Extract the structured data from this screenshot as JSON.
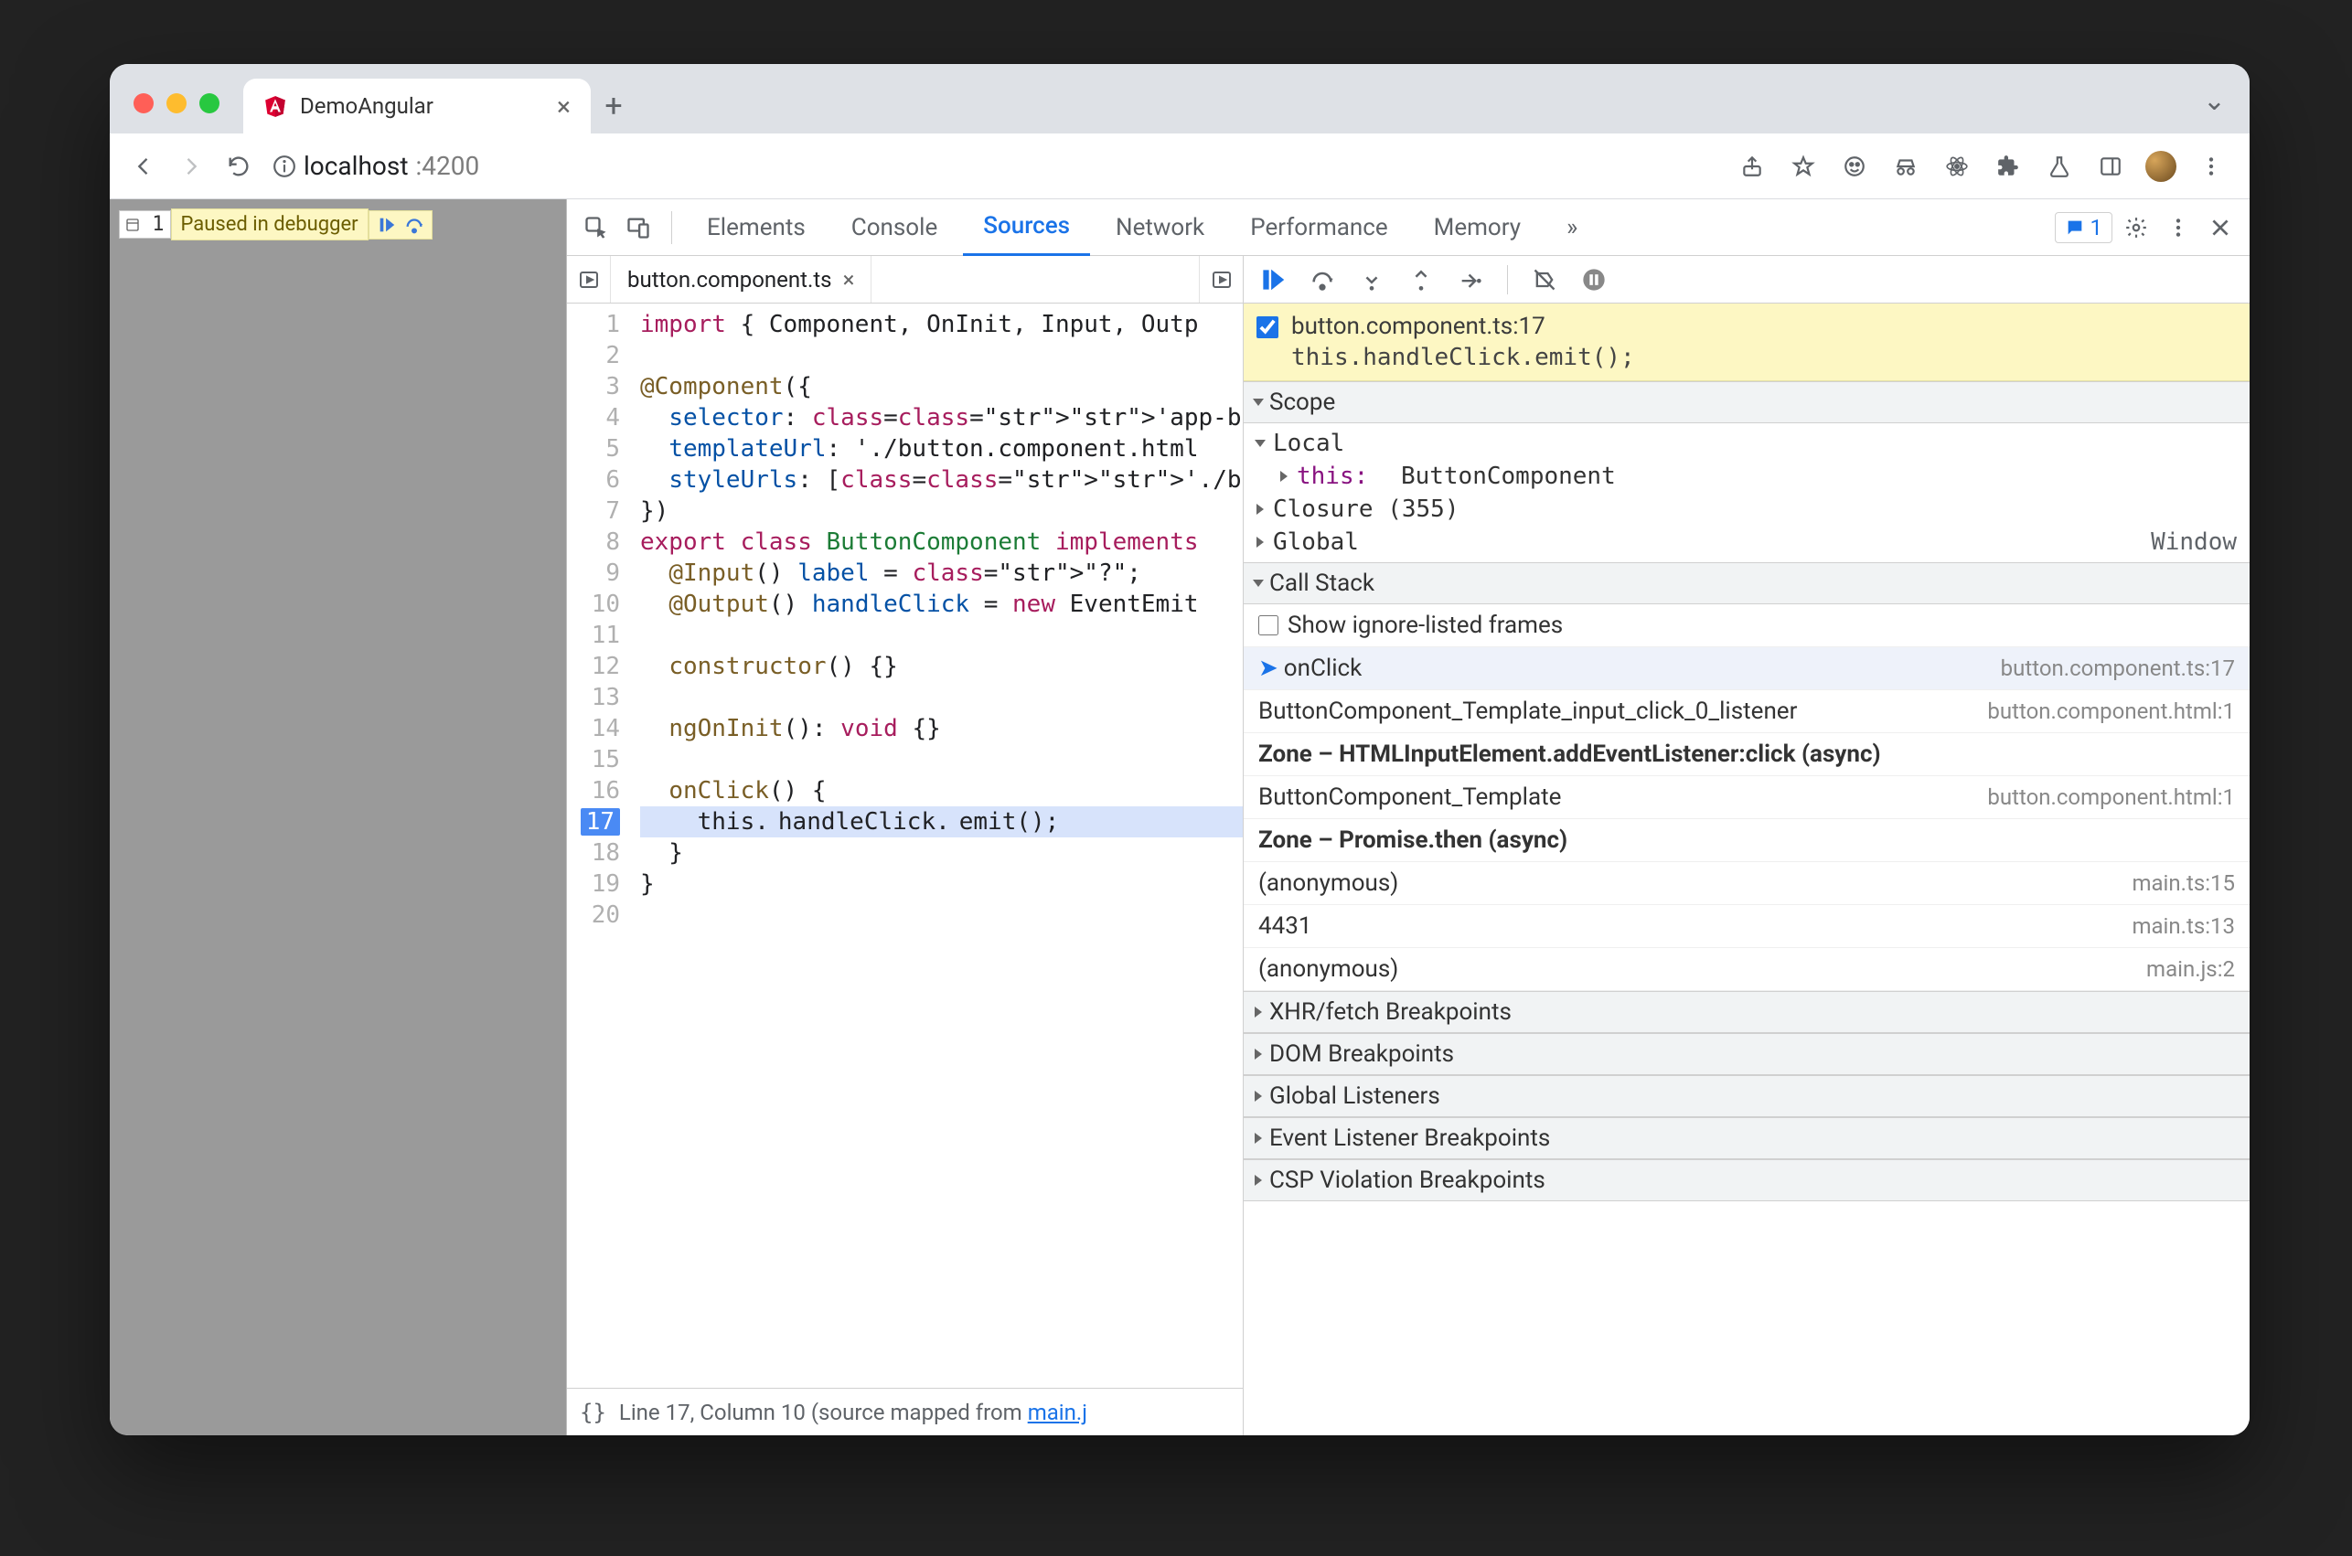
{
  "browser": {
    "tab_title": "DemoAngular",
    "new_tab": "+",
    "url_host": "localhost",
    "url_port": ":4200"
  },
  "paused_overlay": {
    "line_badge": "1",
    "label": "Paused in debugger"
  },
  "devtools_tabs": {
    "elements": "Elements",
    "console": "Console",
    "sources": "Sources",
    "network": "Network",
    "performance": "Performance",
    "memory": "Memory",
    "more": "»",
    "issues_count": "1"
  },
  "file_tab": {
    "name": "button.component.ts"
  },
  "code": {
    "lines": [
      "import { Component, OnInit, Input, Outp",
      "",
      "@Component({",
      "  selector: 'app-button',",
      "  templateUrl: './button.component.html",
      "  styleUrls: ['./button.component.css']",
      "})",
      "export class ButtonComponent implements",
      "  @Input() label = \"?\";",
      "  @Output() handleClick = new EventEmit",
      "",
      "  constructor() {}",
      "",
      "  ngOnInit(): void {}",
      "",
      "  onClick() {",
      "    this.handleClick.emit();",
      "  }",
      "}",
      ""
    ],
    "line_numbers": [
      "1",
      "2",
      "3",
      "4",
      "5",
      "6",
      "7",
      "8",
      "9",
      "10",
      "11",
      "12",
      "13",
      "14",
      "15",
      "16",
      "17",
      "18",
      "19",
      "20"
    ],
    "paused_line_index": 16
  },
  "statusbar": {
    "pretty": "{}",
    "text_prefix": "Line 17, Column 10  (source mapped from ",
    "link": "main.j"
  },
  "breakpoint_banner": {
    "title": "button.component.ts:17",
    "expr": "this.handleClick.emit();"
  },
  "scope": {
    "header": "Scope",
    "local": "Local",
    "this_label": "this:",
    "this_value": "ButtonComponent",
    "closure": "Closure (355)",
    "global": "Global",
    "global_value": "Window"
  },
  "callstack": {
    "header": "Call Stack",
    "show_ignored": "Show ignore-listed frames",
    "frames": [
      {
        "name": "onClick",
        "loc": "button.component.ts:17",
        "current": true
      },
      {
        "name": "ButtonComponent_Template_input_click_0_listener",
        "loc": "button.component.html:1"
      },
      {
        "name": "Zone – HTMLInputElement.addEventListener:click (async)",
        "bold": true
      },
      {
        "name": "ButtonComponent_Template",
        "loc": "button.component.html:1"
      },
      {
        "name": "Zone – Promise.then (async)",
        "bold": true
      },
      {
        "name": "(anonymous)",
        "loc": "main.ts:15"
      },
      {
        "name": "4431",
        "loc": "main.ts:13"
      },
      {
        "name": "(anonymous)",
        "loc": "main.js:2"
      }
    ]
  },
  "panels": {
    "xhr": "XHR/fetch Breakpoints",
    "dom": "DOM Breakpoints",
    "gl": "Global Listeners",
    "ev": "Event Listener Breakpoints",
    "csp": "CSP Violation Breakpoints"
  }
}
